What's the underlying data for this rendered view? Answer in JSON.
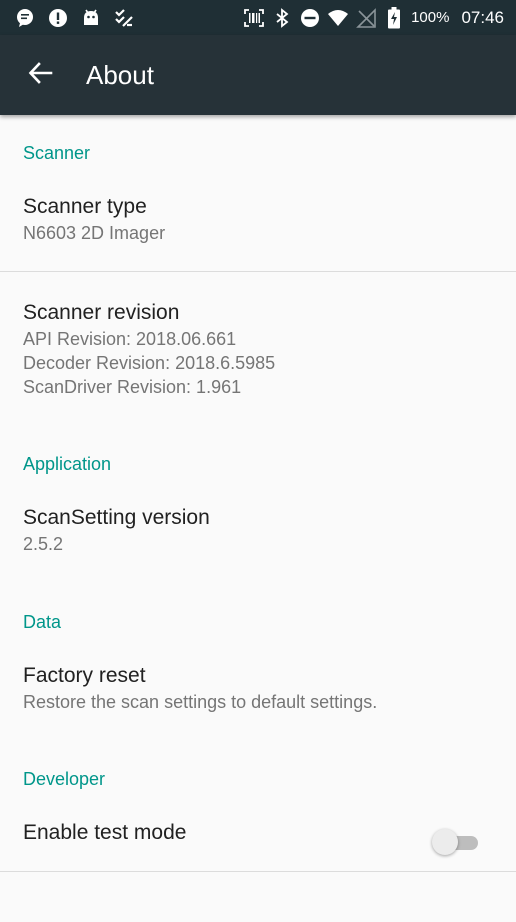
{
  "status_bar": {
    "icons_left": [
      "message-bubble-icon",
      "alert-icon",
      "android-icon",
      "checklist-icon"
    ],
    "icons_right": [
      "scanner-icon",
      "bluetooth-icon",
      "do-not-disturb-icon",
      "wifi-icon",
      "no-sim-icon",
      "battery-charging-icon"
    ],
    "battery_percent": "100%",
    "time": "07:46"
  },
  "app_bar": {
    "title": "About",
    "back_icon": "arrow-back-icon"
  },
  "sections": {
    "scanner": {
      "header": "Scanner",
      "scanner_type": {
        "title": "Scanner type",
        "summary": "N6603 2D Imager"
      },
      "scanner_revision": {
        "title": "Scanner revision",
        "lines": [
          "API Revision: 2018.06.661",
          "Decoder Revision: 2018.6.5985",
          "ScanDriver Revision: 1.961"
        ]
      }
    },
    "application": {
      "header": "Application",
      "version": {
        "title": "ScanSetting version",
        "summary": "2.5.2"
      }
    },
    "data": {
      "header": "Data",
      "factory_reset": {
        "title": "Factory reset",
        "summary": "Restore the scan settings to default settings."
      }
    },
    "developer": {
      "header": "Developer",
      "test_mode": {
        "title": "Enable test mode",
        "checked": false
      }
    }
  },
  "colors": {
    "status_bar": "#1f2f35",
    "app_bar": "#263238",
    "accent": "#00968a",
    "background": "#fafafa"
  }
}
